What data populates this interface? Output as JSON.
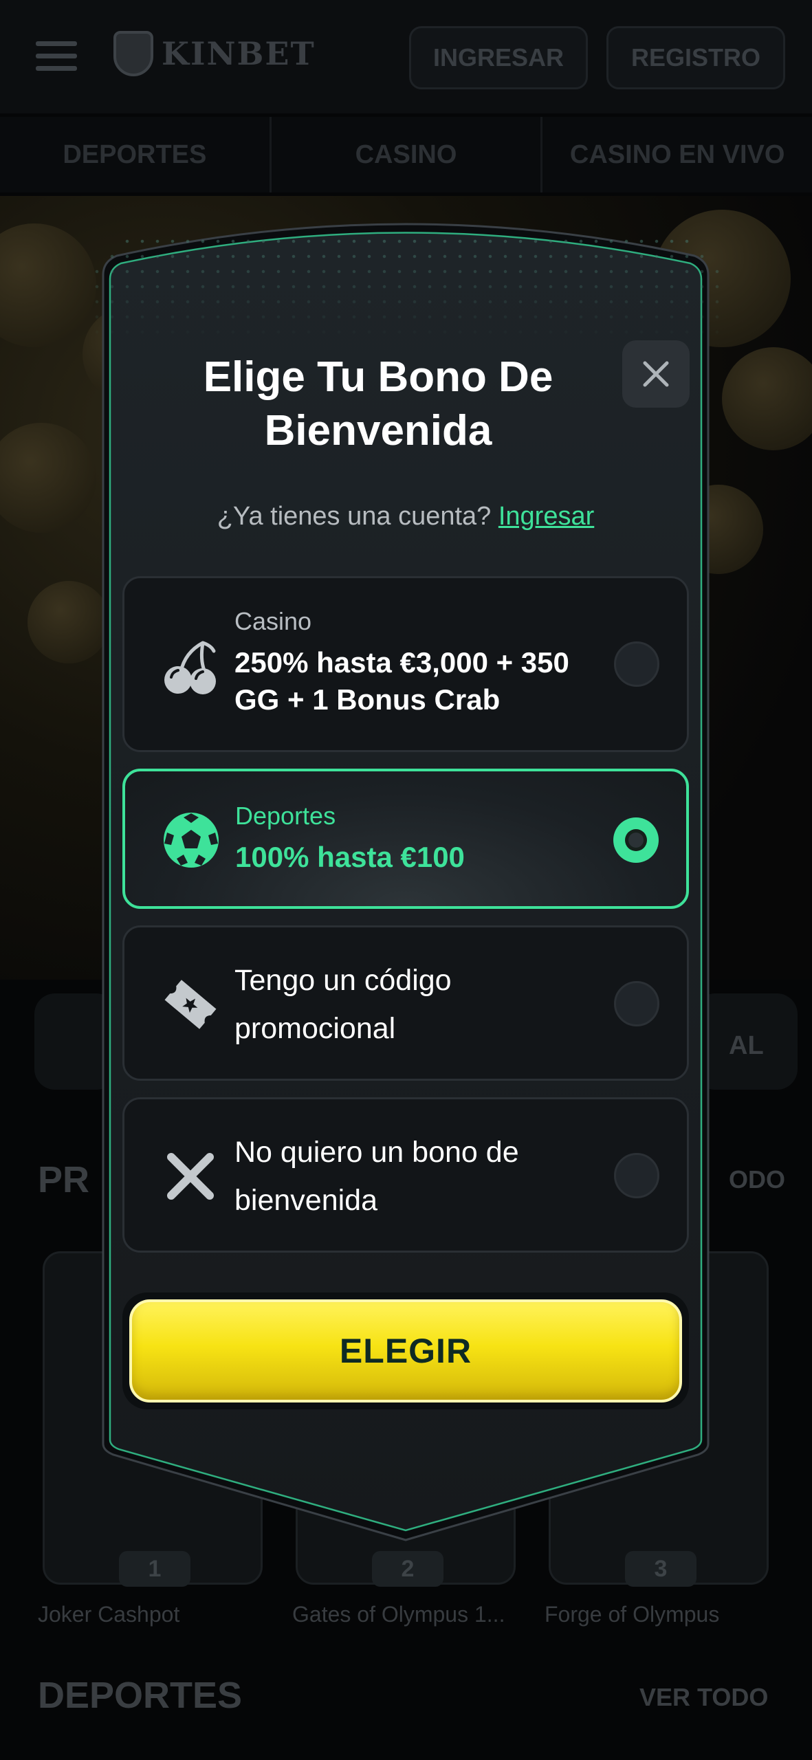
{
  "header": {
    "logo_text": "KINBET",
    "login_label": "INGRESAR",
    "register_label": "REGISTRO"
  },
  "nav": {
    "tabs": [
      "DEPORTES",
      "CASINO",
      "CASINO EN VIVO"
    ]
  },
  "background": {
    "promo_section_title": "PR",
    "promo_section_link": "ODO",
    "side_label": "AL",
    "games": [
      {
        "rank": "1",
        "name": "Joker Cashpot"
      },
      {
        "rank": "2",
        "name": "Gates of Olympus 1..."
      },
      {
        "rank": "3",
        "name": "Forge of Olympus"
      }
    ],
    "sports_section_title": "DEPORTES",
    "sports_section_link": "VER TODO"
  },
  "modal": {
    "title": "Elige Tu Bono De Bienvenida",
    "login_prompt": "¿Ya tienes una cuenta?",
    "login_link": "Ingresar",
    "options": [
      {
        "icon": "cherries-icon",
        "category": "Casino",
        "value": "250% hasta €3,000 + 350 GG + 1 Bonus Crab",
        "selected": false
      },
      {
        "icon": "soccer-ball-icon",
        "category": "Deportes",
        "value": "100% hasta €100",
        "selected": true
      },
      {
        "icon": "ticket-icon",
        "label": "Tengo un código promocional",
        "selected": false
      },
      {
        "icon": "x-icon",
        "label": "No quiero un bono de bienvenida",
        "selected": false
      }
    ],
    "cta_label": "ELEGIR"
  },
  "colors": {
    "accent": "#3ee29a",
    "cta_yellow": "#f7e314",
    "modal_bg": "#1a1e22"
  }
}
